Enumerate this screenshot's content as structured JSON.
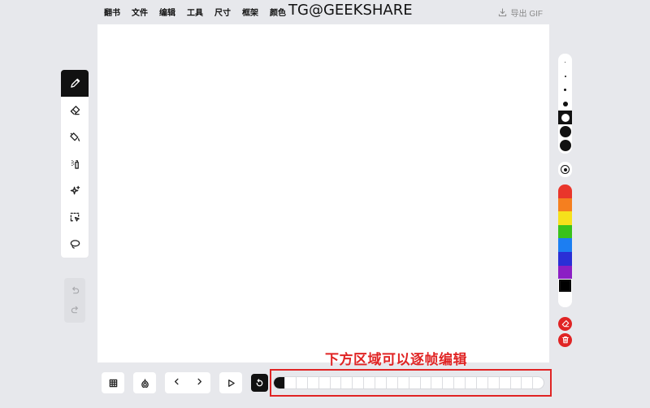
{
  "menu": [
    "翻书",
    "文件",
    "编辑",
    "工具",
    "尺寸",
    "框架",
    "颜色"
  ],
  "watermark": "TG@GEEKSHARE",
  "export_label": "导出 GIF",
  "tools": [
    {
      "icon": "pencil-icon",
      "active": true
    },
    {
      "icon": "eraser-icon",
      "active": false
    },
    {
      "icon": "paint-bucket-icon",
      "active": false
    },
    {
      "icon": "spray-can-icon",
      "active": false
    },
    {
      "icon": "sparkle-icon",
      "active": false
    },
    {
      "icon": "selection-icon",
      "active": false
    },
    {
      "icon": "lasso-icon",
      "active": false
    }
  ],
  "history": [
    "undo-icon",
    "redo-icon"
  ],
  "brush_sizes": [
    1,
    2,
    3,
    6,
    10,
    14,
    14
  ],
  "selected_brush_index": 4,
  "colors": [
    "#e9362b",
    "#f57f1f",
    "#f6e11b",
    "#39c21b",
    "#1c7ef2",
    "#2a2fd6",
    "#8b1fc4",
    "#000000"
  ],
  "selected_color": "#000000",
  "accent": "#e02424",
  "annotation": "下方区域可以逐帧编辑",
  "frame_count": 24,
  "current_frame": 1
}
